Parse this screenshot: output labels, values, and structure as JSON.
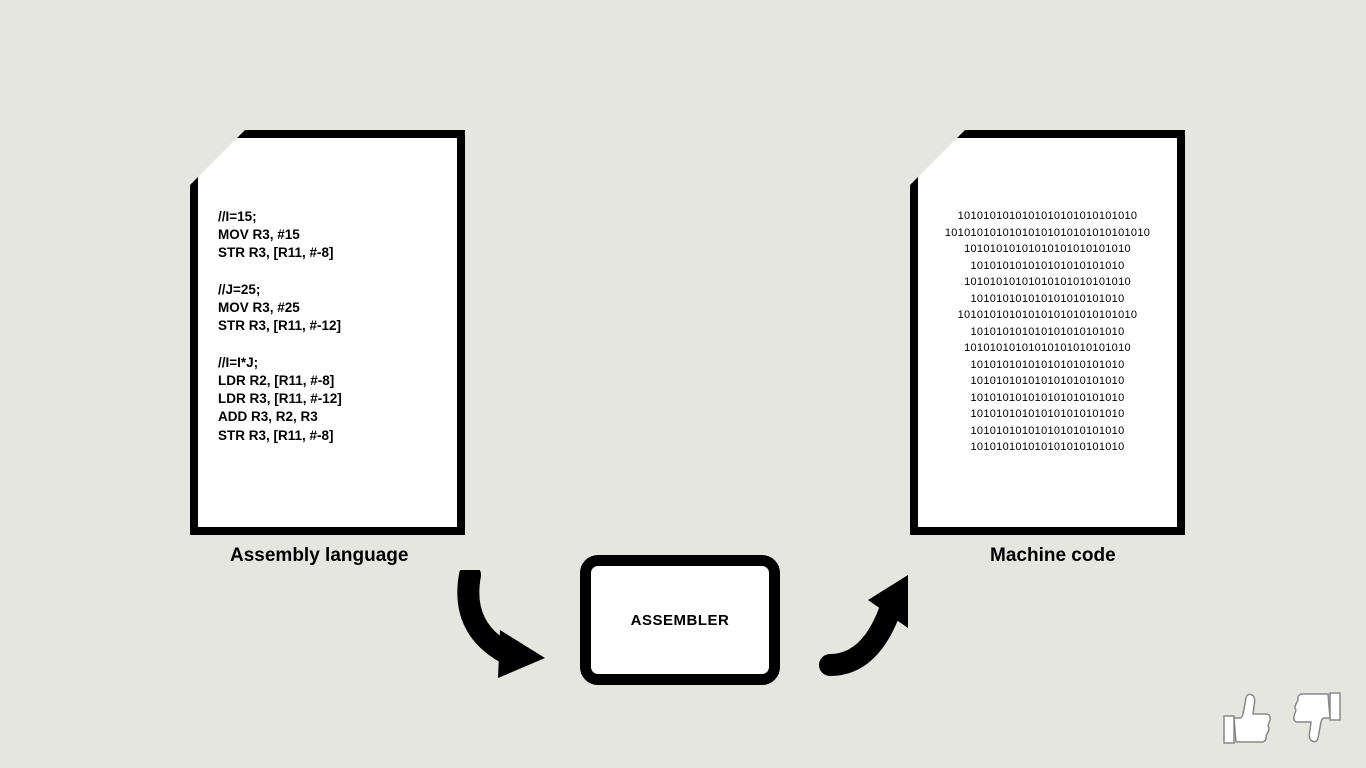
{
  "left_doc": {
    "label": "Assembly language",
    "code": "//I=15;\nMOV R3, #15\nSTR R3, [R11, #-8]\n\n//J=25;\nMOV R3, #25\nSTR R3, [R11, #-12]\n\n//I=I*J;\nLDR R2, [R11, #-8]\nLDR R3, [R11, #-12]\nADD R3, R2, R3\nSTR R3, [R11, #-8]"
  },
  "right_doc": {
    "label": "Machine code",
    "binary": "1010101010101010101010101010\n10101010101010101010101010101010\n10101010101010101010101010\n101010101010101010101010\n10101010101010101010101010\n101010101010101010101010\n1010101010101010101010101010\n101010101010101010101010\n10101010101010101010101010\n101010101010101010101010\n101010101010101010101010\n101010101010101010101010\n101010101010101010101010\n101010101010101010101010\n101010101010101010101010"
  },
  "assembler_box": {
    "label": "ASSEMBLER"
  }
}
